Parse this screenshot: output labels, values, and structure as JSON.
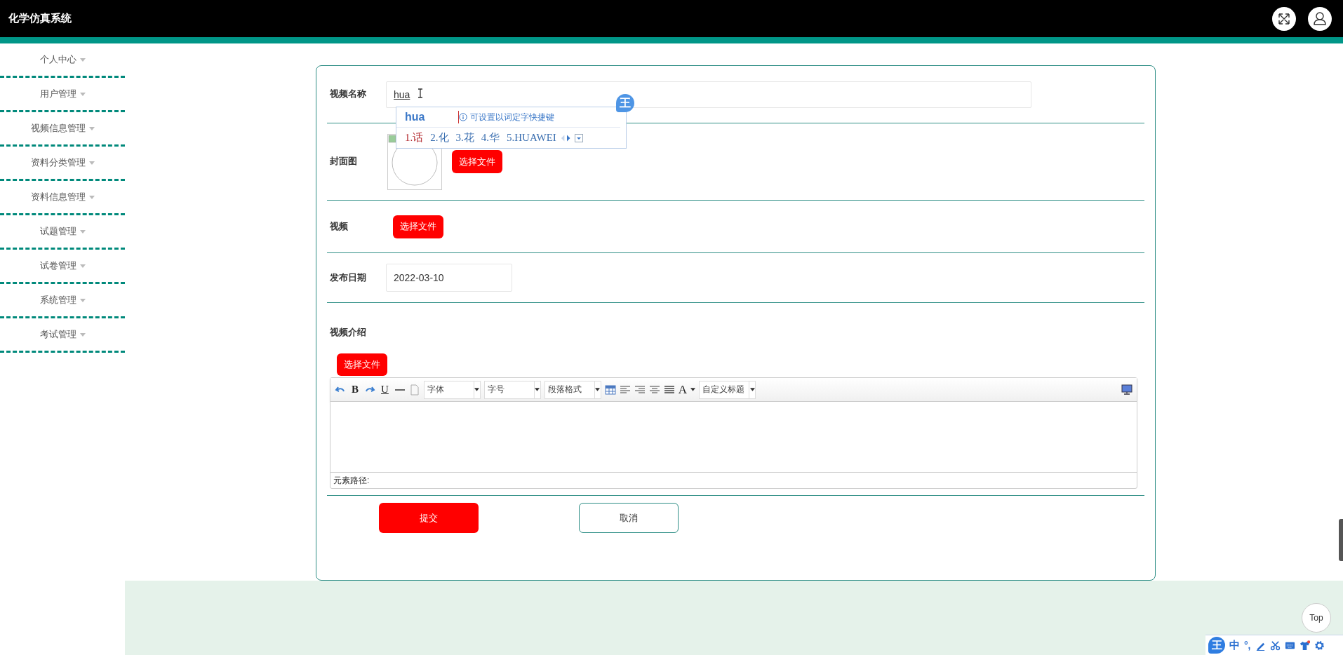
{
  "header": {
    "title": "化学仿真系统"
  },
  "sidebar": {
    "items": [
      {
        "label": "个人中心"
      },
      {
        "label": "用户管理"
      },
      {
        "label": "视频信息管理"
      },
      {
        "label": "资料分类管理"
      },
      {
        "label": "资料信息管理"
      },
      {
        "label": "试题管理"
      },
      {
        "label": "试卷管理"
      },
      {
        "label": "系统管理"
      },
      {
        "label": "考试管理"
      }
    ]
  },
  "form": {
    "fields": [
      {
        "kind": "text",
        "label": "视频名称",
        "value": "hua"
      },
      {
        "kind": "image",
        "label": "封面图",
        "button": "选择文件"
      },
      {
        "kind": "file",
        "label": "视频",
        "button": "选择文件"
      },
      {
        "kind": "date",
        "label": "发布日期",
        "value": "2022-03-10"
      },
      {
        "kind": "editor",
        "label": "视频介绍",
        "button": "选择文件",
        "path_label": "元素路径:",
        "toolbar": [
          {
            "kind": "undo"
          },
          {
            "kind": "bold",
            "text": "B"
          },
          {
            "kind": "redo"
          },
          {
            "kind": "underline",
            "text": "U"
          },
          {
            "kind": "rule"
          },
          {
            "kind": "page"
          },
          {
            "kind": "combo",
            "text": "字体"
          },
          {
            "kind": "combo",
            "text": "字号"
          },
          {
            "kind": "combo",
            "text": "段落格式"
          },
          {
            "kind": "table"
          },
          {
            "kind": "align-left"
          },
          {
            "kind": "align-right"
          },
          {
            "kind": "align-center"
          },
          {
            "kind": "justify"
          },
          {
            "kind": "color",
            "text": "A"
          },
          {
            "kind": "combo",
            "text": "自定义标题"
          },
          {
            "kind": "fullscreen"
          }
        ]
      }
    ],
    "actions": [
      {
        "kind": "primary",
        "label": "提交"
      },
      {
        "kind": "secondary",
        "label": "取消"
      }
    ]
  },
  "ime_popup": {
    "composition": "hua",
    "hint": "可设置以词定字快捷键",
    "badge": "王",
    "candidates": [
      {
        "label": "1.话",
        "selected": true
      },
      {
        "label": "2.化",
        "selected": false
      },
      {
        "label": "3.花",
        "selected": false
      },
      {
        "label": "4.华",
        "selected": false
      },
      {
        "label": "5.HUAWEI",
        "selected": false
      }
    ]
  },
  "top_button": "Top",
  "ime_bar": {
    "logo": "王",
    "mode": "中",
    "punct": "°,"
  }
}
